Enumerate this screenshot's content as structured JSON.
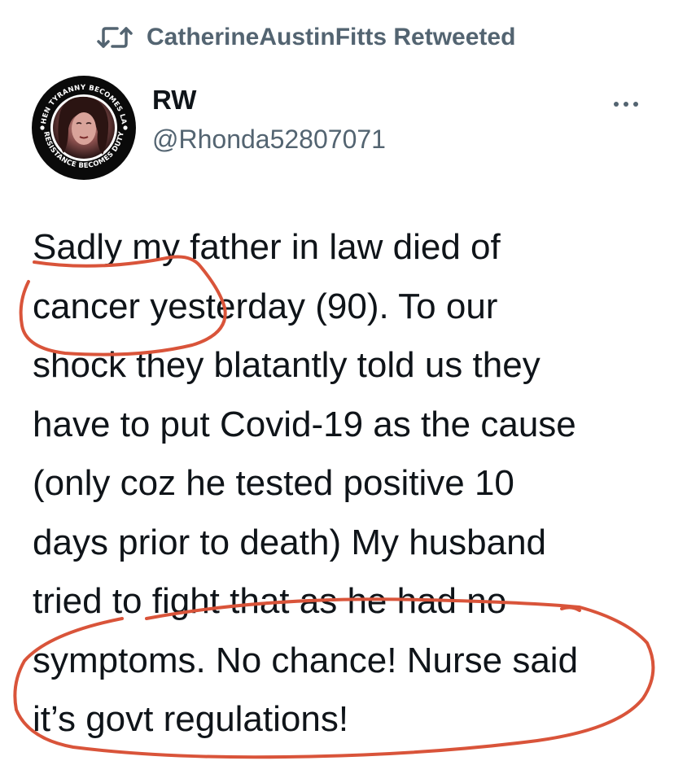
{
  "retweet_banner": {
    "text": "CatherineAustinFitts Retweeted",
    "icon": "retweet-icon"
  },
  "author": {
    "name": "RW",
    "handle": "@Rhonda52807071",
    "avatar": {
      "ring_text_top": "WHEN TYRANNY BECOMES LAW",
      "ring_text_bottom": "RESISTANCE BECOMES DUTY"
    }
  },
  "more_icon": "more-horizontal-icon",
  "tweet": {
    "text": "Sadly my father in law died of\ncancer yesterday (90). To our\nshock they blatantly told us they\nhave to put Covid-19 as the cause\n(only coz he tested positive 10\ndays prior to death) My husband\ntried to fight that as he had no\nsymptoms. No chance! Nurse said\nit’s govt regulations!"
  },
  "colors": {
    "secondary_text": "#536471",
    "primary_text": "#0f1419",
    "annotation_red": "#d9543a"
  }
}
